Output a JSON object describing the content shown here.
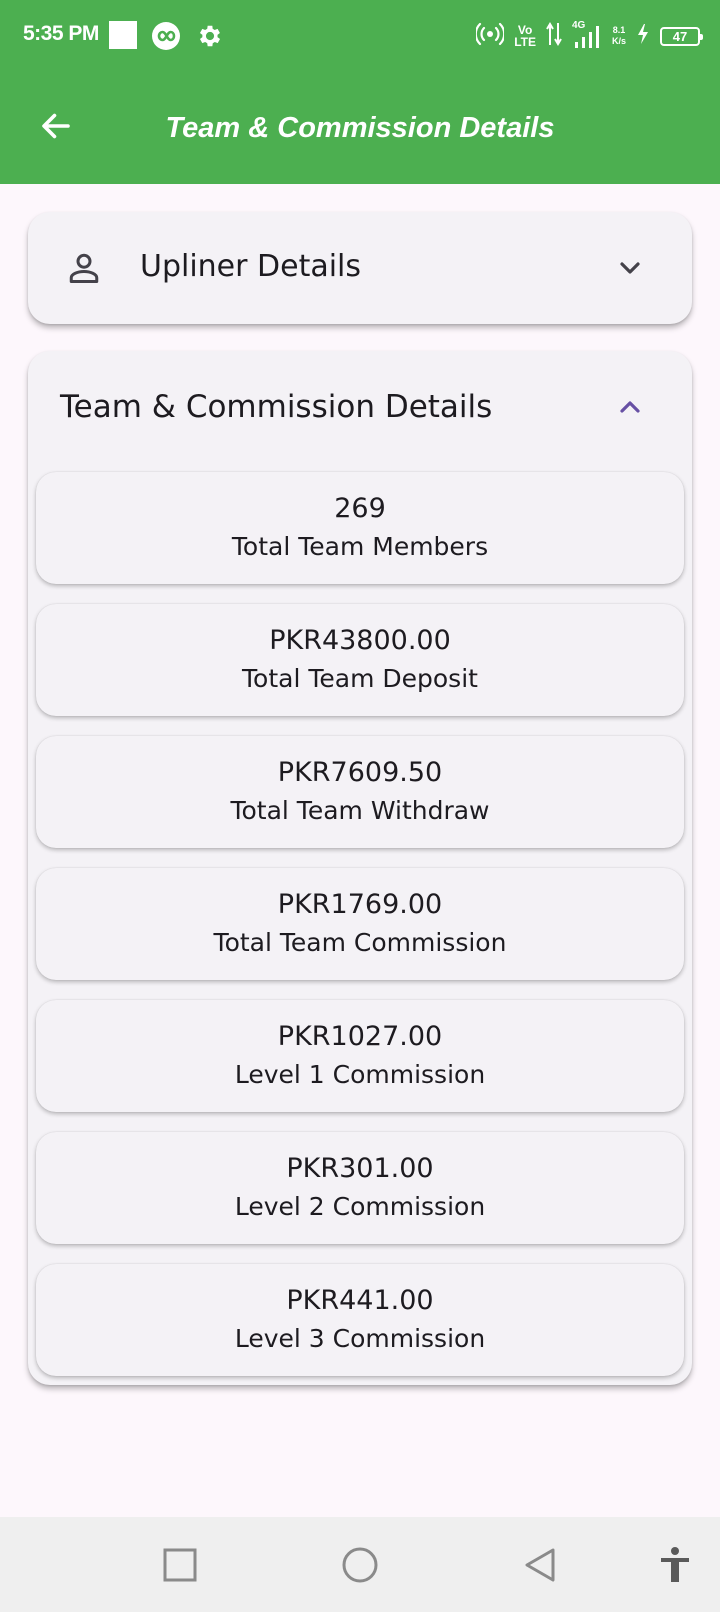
{
  "status_bar": {
    "time": "5:35 PM",
    "network_speed_top": "8.1",
    "network_speed_bottom": "K/s",
    "volte_top": "Vo",
    "volte_bottom": "LTE",
    "network_type": "4G",
    "battery": "47",
    "icons": [
      "notification-square-icon",
      "infinity-app-icon",
      "gear-icon",
      "hotspot-icon",
      "data-arrows-icon",
      "signal-icon",
      "charging-bolt-icon",
      "battery-icon"
    ]
  },
  "app_bar": {
    "title": "Team & Commission Details",
    "back_icon": "arrow-left-icon",
    "background": "#4caf50"
  },
  "upliner_section": {
    "title": "Upliner Details",
    "icon": "person-icon",
    "expanded": false
  },
  "team_section": {
    "title": "Team & Commission Details",
    "expanded": true,
    "accent": "#6750a4",
    "stats": [
      {
        "value": "269",
        "label": "Total Team Members"
      },
      {
        "value": "PKR43800.00",
        "label": "Total Team Deposit"
      },
      {
        "value": "PKR7609.50",
        "label": "Total Team Withdraw"
      },
      {
        "value": "PKR1769.00",
        "label": "Total Team Commission"
      },
      {
        "value": "PKR1027.00",
        "label": "Level 1 Commission"
      },
      {
        "value": "PKR301.00",
        "label": "Level 2 Commission"
      },
      {
        "value": "PKR441.00",
        "label": "Level 3 Commission"
      }
    ]
  },
  "nav_bar": {
    "buttons": [
      "recents-square-icon",
      "home-circle-icon",
      "back-triangle-icon",
      "accessibility-icon"
    ]
  }
}
